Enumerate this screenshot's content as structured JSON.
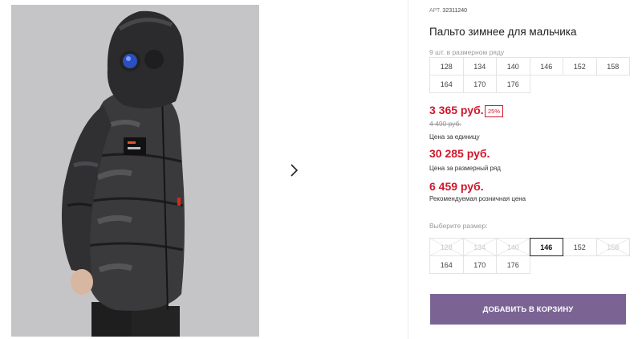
{
  "product": {
    "article_label": "АРТ.",
    "article_value": "32311240",
    "title": "Пальто зимнее для мальчика",
    "range_note": "9 шт. в размерном ряду"
  },
  "size_range": [
    "128",
    "134",
    "140",
    "146",
    "152",
    "158",
    "164",
    "170",
    "176"
  ],
  "pricing": {
    "unit_price": "3 365 руб.",
    "discount_badge": "25%",
    "old_price": "4 490 руб.",
    "unit_label": "Цена за единицу",
    "range_price": "30 285 руб.",
    "range_label": "Цена за размерный ряд",
    "retail_price": "6 459 руб.",
    "retail_label": "Рекомендуемая розничная цена"
  },
  "size_select": {
    "label": "Выберите размер:",
    "options": [
      {
        "value": "128",
        "state": "disabled"
      },
      {
        "value": "134",
        "state": "disabled"
      },
      {
        "value": "140",
        "state": "disabled"
      },
      {
        "value": "146",
        "state": "selected"
      },
      {
        "value": "152",
        "state": "available"
      },
      {
        "value": "158",
        "state": "disabled"
      },
      {
        "value": "164",
        "state": "available"
      },
      {
        "value": "170",
        "state": "available"
      },
      {
        "value": "176",
        "state": "available"
      }
    ]
  },
  "actions": {
    "add_to_cart": "ДОБАВИТЬ В КОРЗИНУ"
  },
  "gallery": {
    "next_icon": "chevron-right-icon"
  },
  "colors": {
    "accent_price": "#d0172b",
    "button_bg": "#7b6494"
  }
}
